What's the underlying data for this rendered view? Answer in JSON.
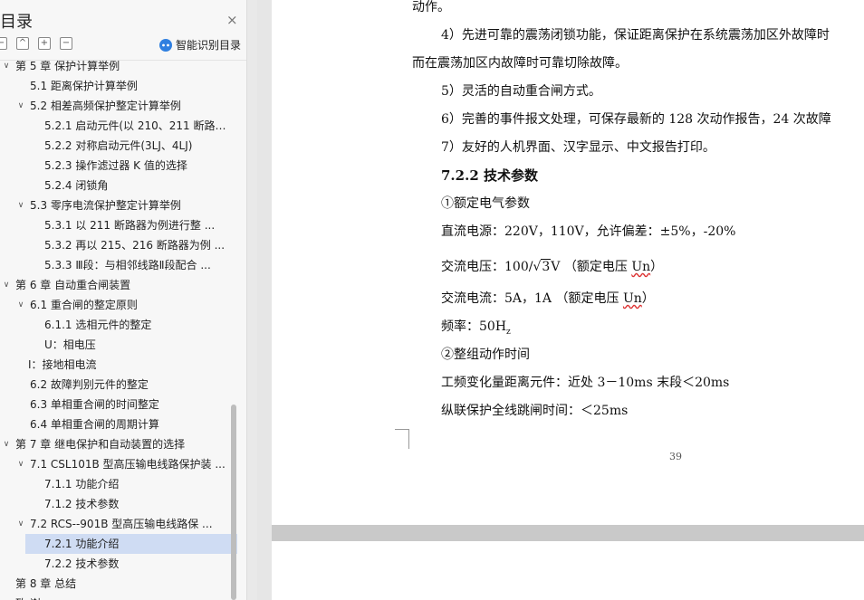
{
  "sidebar": {
    "title": "目录",
    "close_icon": "×",
    "toolbar": {
      "collapse_label": "−",
      "expand_up_label": "^",
      "add_label": "+",
      "remove_label": "−"
    },
    "smart_label": "智能识别目录",
    "items": [
      {
        "label": "第 5 章   保护计算举例",
        "level": 1,
        "arrow": "∨"
      },
      {
        "label": "5.1  距离保护计算举例",
        "level": 2,
        "arrow": ""
      },
      {
        "label": "5.2   相差高频保护整定计算举例",
        "level": 2,
        "arrow": "∨"
      },
      {
        "label": "5.2.1 启动元件(以 210、211 断路 ...",
        "level": 3,
        "arrow": ""
      },
      {
        "label": "5.2.2 对称启动元件(3LJ、4LJ)",
        "level": 3,
        "arrow": ""
      },
      {
        "label": "5.2.3 操作滤过器 K 值的选择",
        "level": 3,
        "arrow": ""
      },
      {
        "label": "5.2.4   闭锁角",
        "level": 3,
        "arrow": ""
      },
      {
        "label": "5.3   零序电流保护整定计算举例",
        "level": 2,
        "arrow": "∨"
      },
      {
        "label": "5.3.1   以 211 断路器为例进行整 ...",
        "level": 3,
        "arrow": ""
      },
      {
        "label": "5.3.2   再以 215、216 断路器为例 ...",
        "level": 3,
        "arrow": ""
      },
      {
        "label": "5.3.3   Ⅲ段：与相邻线路Ⅱ段配合 ...",
        "level": 3,
        "arrow": ""
      },
      {
        "label": "第 6 章   自动重合闸装置",
        "level": 1,
        "arrow": "∨"
      },
      {
        "label": "6.1  重合闸的整定原则",
        "level": 2,
        "arrow": "∨"
      },
      {
        "label": "6.1.1 选相元件的整定",
        "level": 3,
        "arrow": ""
      },
      {
        "label": "U：相电压",
        "level": 3,
        "arrow": ""
      },
      {
        "label": "I：接地相电流",
        "level": 2,
        "arrow": ""
      },
      {
        "label": "6.2   故障判别元件的整定",
        "level": 2,
        "arrow": ""
      },
      {
        "label": "6.3  单相重合闸的时间整定",
        "level": 2,
        "arrow": ""
      },
      {
        "label": "6.4   单相重合闸的周期计算",
        "level": 2,
        "arrow": ""
      },
      {
        "label": "第 7 章  继电保护和自动装置的选择",
        "level": 1,
        "arrow": "∨"
      },
      {
        "label": "7.1 CSL101B 型高压输电线路保护装 ...",
        "level": 2,
        "arrow": "∨"
      },
      {
        "label": "7.1.1 功能介绍",
        "level": 3,
        "arrow": ""
      },
      {
        "label": "7.1.2 技术参数",
        "level": 3,
        "arrow": ""
      },
      {
        "label": "7.2   RCS--901B 型高压输电线路保 ...",
        "level": 2,
        "arrow": "∨"
      },
      {
        "label": "7.2.1 功能介绍",
        "level": 3,
        "arrow": "",
        "selected": true
      },
      {
        "label": "7.2.2   技术参数",
        "level": 3,
        "arrow": ""
      },
      {
        "label": "第 8 章   总结",
        "level": 1,
        "arrow": ""
      },
      {
        "label": "致    谢",
        "level": 1,
        "arrow": ""
      }
    ]
  },
  "document": {
    "lines": [
      "动作。",
      "4）先进可靠的震荡闭锁功能，保证距离保护在系统震荡加区外故障时",
      "而在震荡加区内故障时可靠切除故障。",
      "5）灵活的自动重合闸方式。",
      "6）完善的事件报文处理，可保存最新的 128 次动作报告，24 次故障",
      "7）友好的人机界面、汉字显示、中文报告打印。",
      "7.2.2   技术参数",
      "①额定电气参数",
      "直流电源：220V，110V，允许偏差：±5%，-20%"
    ],
    "ac_voltage": {
      "prefix": "交流电压：100/",
      "root": "3",
      "suffix": "V  （额定电压 ",
      "underlined": "Un",
      "end": "）"
    },
    "ac_current": {
      "prefix": "交流电流：5A，1A      （额定电压 ",
      "underlined": "Un",
      "end": "）"
    },
    "frequency": {
      "prefix": "频率：50H",
      "sub": "z"
    },
    "lines2": [
      "②整组动作时间",
      "工频变化量距离元件：近处 3－10ms     末段＜20ms",
      "纵联保护全线跳闸时间：＜25ms"
    ],
    "page_number": "39"
  }
}
